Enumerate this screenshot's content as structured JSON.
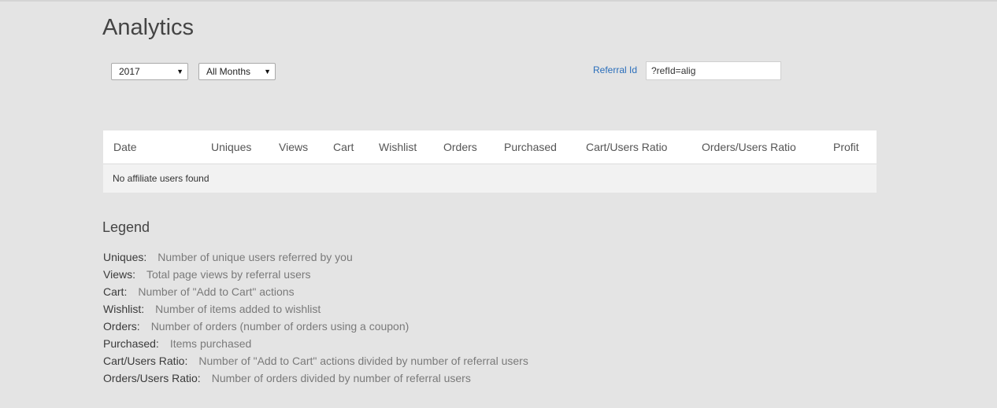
{
  "page": {
    "title": "Analytics"
  },
  "filters": {
    "year": "2017",
    "month": "All Months",
    "referral_label": "Referral Id",
    "referral_value": "?refId=alig"
  },
  "table": {
    "headers": [
      "Date",
      "Uniques",
      "Views",
      "Cart",
      "Wishlist",
      "Orders",
      "Purchased",
      "Cart/Users Ratio",
      "Orders/Users Ratio",
      "Profit"
    ],
    "empty_message": "No affiliate users found"
  },
  "legend": {
    "title": "Legend",
    "items": [
      {
        "term": "Uniques:",
        "desc": "Number of unique users referred by you"
      },
      {
        "term": "Views:",
        "desc": "Total page views by referral users"
      },
      {
        "term": "Cart:",
        "desc": "Number of \"Add to Cart\" actions"
      },
      {
        "term": "Wishlist:",
        "desc": "Number of items added to wishlist"
      },
      {
        "term": "Orders:",
        "desc": "Number of orders (number of orders using a coupon)"
      },
      {
        "term": "Purchased:",
        "desc": "Items purchased"
      },
      {
        "term": "Cart/Users Ratio:",
        "desc": "Number of \"Add to Cart\" actions divided by number of referral users"
      },
      {
        "term": "Orders/Users Ratio:",
        "desc": "Number of orders divided by number of referral users"
      }
    ]
  }
}
